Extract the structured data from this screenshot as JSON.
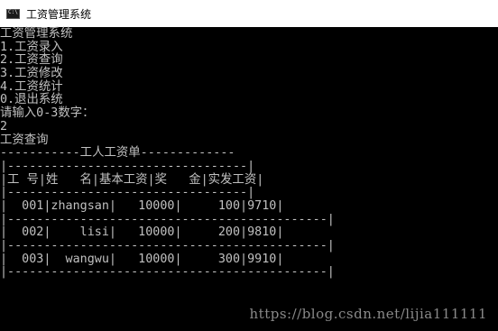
{
  "window": {
    "title": "工资管理系统"
  },
  "console": {
    "lines": [
      "工资管理系统",
      "1.工资录入",
      "2.工资查询",
      "3.工资修改",
      "4.工资统计",
      "0.退出系统",
      "请输入0-3数字：",
      "2",
      "工资查询",
      "-----------工人工资单-------------",
      "|---------------------------------|",
      "|工 号|姓   名|基本工资|奖   金|实发工资|",
      "|---------------------------------|",
      "|  001|zhangsan|   10000|     100|9710|",
      "|--------------------------------------------|",
      "|  002|    lisi|   10000|     200|9810|",
      "|--------------------------------------------|",
      "|  003|  wangwu|   10000|     300|9910|",
      "|--------------------------------------------|"
    ]
  },
  "watermark": "https://blog.csdn.net/lijia111111"
}
